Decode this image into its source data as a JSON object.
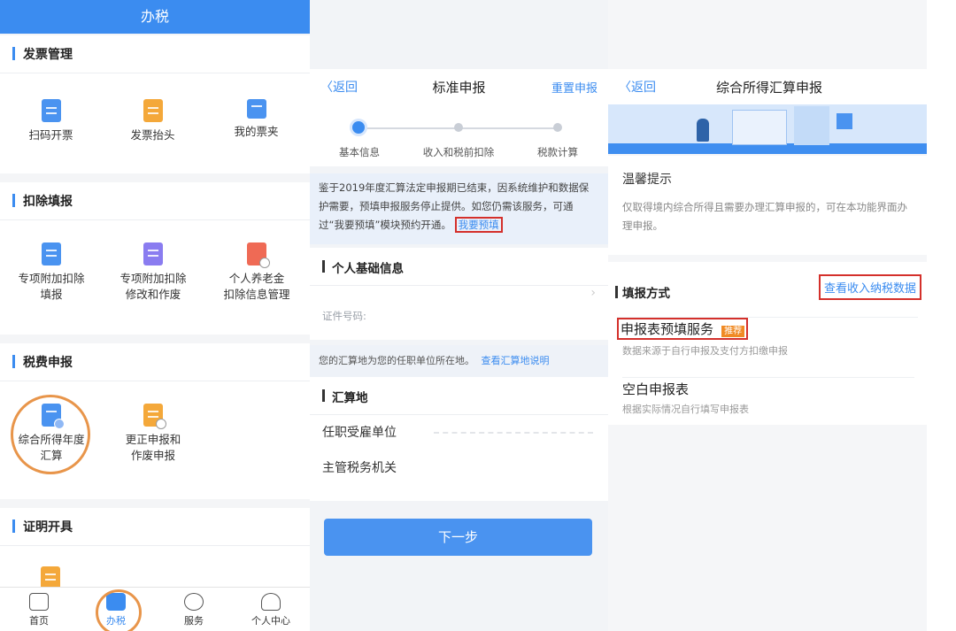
{
  "panel1": {
    "header_title": "办税",
    "sections": [
      {
        "title": "发票管理",
        "items": [
          "扫码开票",
          "发票抬头",
          "我的票夹"
        ]
      },
      {
        "title": "扣除填报",
        "items": [
          [
            "专项附加扣除",
            "填报"
          ],
          [
            "专项附加扣除",
            "修改和作废"
          ],
          [
            "个人养老金",
            "扣除信息管理"
          ]
        ]
      },
      {
        "title": "税费申报",
        "items": [
          [
            "综合所得年度",
            "汇算"
          ],
          [
            "更正申报和",
            "作废申报"
          ]
        ]
      },
      {
        "title": "证明开具"
      }
    ],
    "tabs": [
      "首页",
      "办税",
      "服务",
      "个人中心"
    ],
    "active_tab": "办税"
  },
  "panel2": {
    "back": "〈返回",
    "title": "标准申报",
    "right_action": "重置申报",
    "steps": [
      "基本信息",
      "收入和税前扣除",
      "税款计算"
    ],
    "notice_text": "鉴于2019年度汇算法定申报期已结束，因系统维护和数据保护需要，预填申报服务停止提供。如您仍需该服务，可通过“我要预填”模块预约开通。",
    "notice_link": "我要预填",
    "personal_info_title": "个人基础信息",
    "id_label": "证件号码:",
    "location_note": "您的汇算地为您的任职单位所在地。",
    "location_link": "查看汇算地说明",
    "settle_title": "汇算地",
    "employer_label": "任职受雇单位",
    "tax_office_label": "主管税务机关",
    "next_button": "下一步"
  },
  "panel3": {
    "back": "〈返回",
    "title": "综合所得汇算申报",
    "tip_title": "温馨提示",
    "tip_body": "仅取得境内综合所得且需要办理汇算申报的，可在本功能界面办理申报。",
    "method_title": "填报方式",
    "view_data": "查看收入纳税数据",
    "option1_title": "申报表预填服务",
    "option1_tag": "推荐",
    "option1_desc": "数据来源于自行申报及支付方扣缴申报",
    "option2_title": "空白申报表",
    "option2_desc": "根据实际情况自行填写申报表"
  }
}
